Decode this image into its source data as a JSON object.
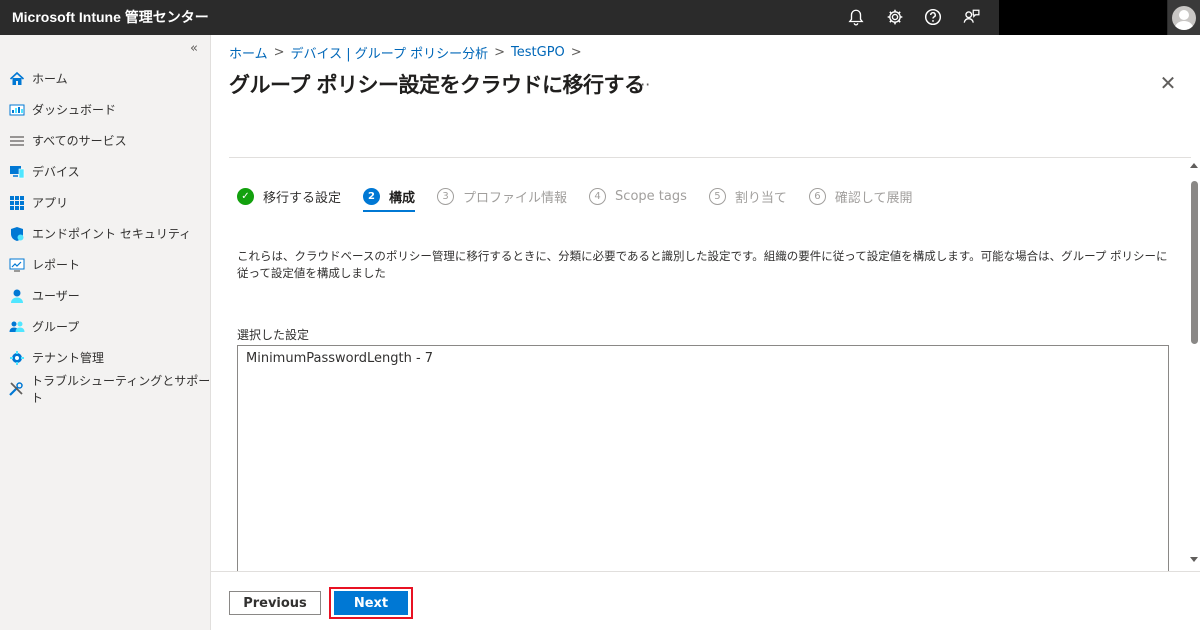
{
  "header": {
    "app_title": "Microsoft Intune 管理センター",
    "icons": [
      "bell-icon",
      "gear-icon",
      "help-icon",
      "feedback-icon"
    ]
  },
  "sidebar": {
    "collapse_label": "«",
    "items": [
      {
        "label": "ホーム",
        "icon": "home-icon"
      },
      {
        "label": "ダッシュボード",
        "icon": "dashboard-icon"
      },
      {
        "label": "すべてのサービス",
        "icon": "list-icon"
      },
      {
        "label": "デバイス",
        "icon": "devices-icon"
      },
      {
        "label": "アプリ",
        "icon": "apps-icon"
      },
      {
        "label": "エンドポイント セキュリティ",
        "icon": "shield-icon"
      },
      {
        "label": "レポート",
        "icon": "report-icon"
      },
      {
        "label": "ユーザー",
        "icon": "user-icon"
      },
      {
        "label": "グループ",
        "icon": "group-icon"
      },
      {
        "label": "テナント管理",
        "icon": "tenant-icon"
      },
      {
        "label": "トラブルシューティングとサポート",
        "icon": "tools-icon"
      }
    ]
  },
  "breadcrumb": {
    "items": [
      "ホーム",
      "デバイス | グループ ポリシー分析",
      "TestGPO"
    ],
    "separator": ">"
  },
  "page": {
    "title": "グループ ポリシー設定をクラウドに移行する",
    "more_label": "···",
    "close_label": "✕"
  },
  "steps": [
    {
      "num": "✓",
      "label": "移行する設定",
      "state": "done"
    },
    {
      "num": "2",
      "label": "構成",
      "state": "active"
    },
    {
      "num": "3",
      "label": "プロファイル情報",
      "state": "pending"
    },
    {
      "num": "4",
      "label": "Scope tags",
      "state": "pending"
    },
    {
      "num": "5",
      "label": "割り当て",
      "state": "pending"
    },
    {
      "num": "6",
      "label": "確認して展開",
      "state": "pending"
    }
  ],
  "content": {
    "description": "これらは、クラウドベースのポリシー管理に移行するときに、分類に必要であると識別した設定です。組織の要件に従って設定値を構成します。可能な場合は、グループ ポリシーに従って設定値を構成しました",
    "selected_label": "選択した設定",
    "selected_value": "MinimumPasswordLength - 7"
  },
  "footer": {
    "previous_label": "Previous",
    "next_label": "Next"
  },
  "colors": {
    "accent": "#0078d4",
    "done": "#13a10e",
    "highlight": "#e81123"
  }
}
